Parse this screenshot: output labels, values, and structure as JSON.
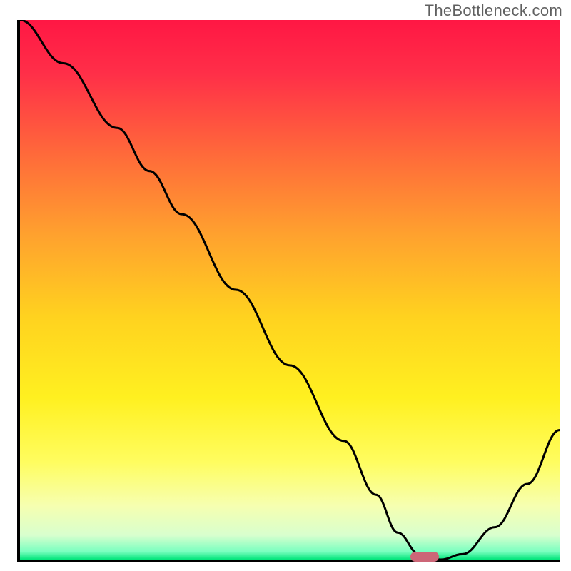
{
  "watermark": "TheBottleneck.com",
  "chart_data": {
    "type": "line",
    "title": "",
    "xlabel": "",
    "ylabel": "",
    "xlim": [
      0,
      100
    ],
    "ylim": [
      0,
      100
    ],
    "x": [
      0,
      8,
      18,
      24,
      30,
      40,
      50,
      60,
      66,
      70,
      74,
      78,
      82,
      88,
      94,
      100
    ],
    "values": [
      100,
      92,
      80,
      72,
      64,
      50,
      36,
      22,
      12,
      5,
      1,
      0,
      1,
      6,
      14,
      24
    ],
    "marker": {
      "x": 75,
      "y": 0.5
    },
    "gradient_stops": [
      {
        "pos": 0.0,
        "color": "#ff1744"
      },
      {
        "pos": 0.1,
        "color": "#ff2f48"
      },
      {
        "pos": 0.25,
        "color": "#ff6a3a"
      },
      {
        "pos": 0.4,
        "color": "#ffa22e"
      },
      {
        "pos": 0.55,
        "color": "#ffd21f"
      },
      {
        "pos": 0.7,
        "color": "#fff020"
      },
      {
        "pos": 0.82,
        "color": "#fffd60"
      },
      {
        "pos": 0.9,
        "color": "#f6ffb0"
      },
      {
        "pos": 0.955,
        "color": "#d8ffce"
      },
      {
        "pos": 0.985,
        "color": "#7affc0"
      },
      {
        "pos": 1.0,
        "color": "#00e47a"
      }
    ]
  }
}
